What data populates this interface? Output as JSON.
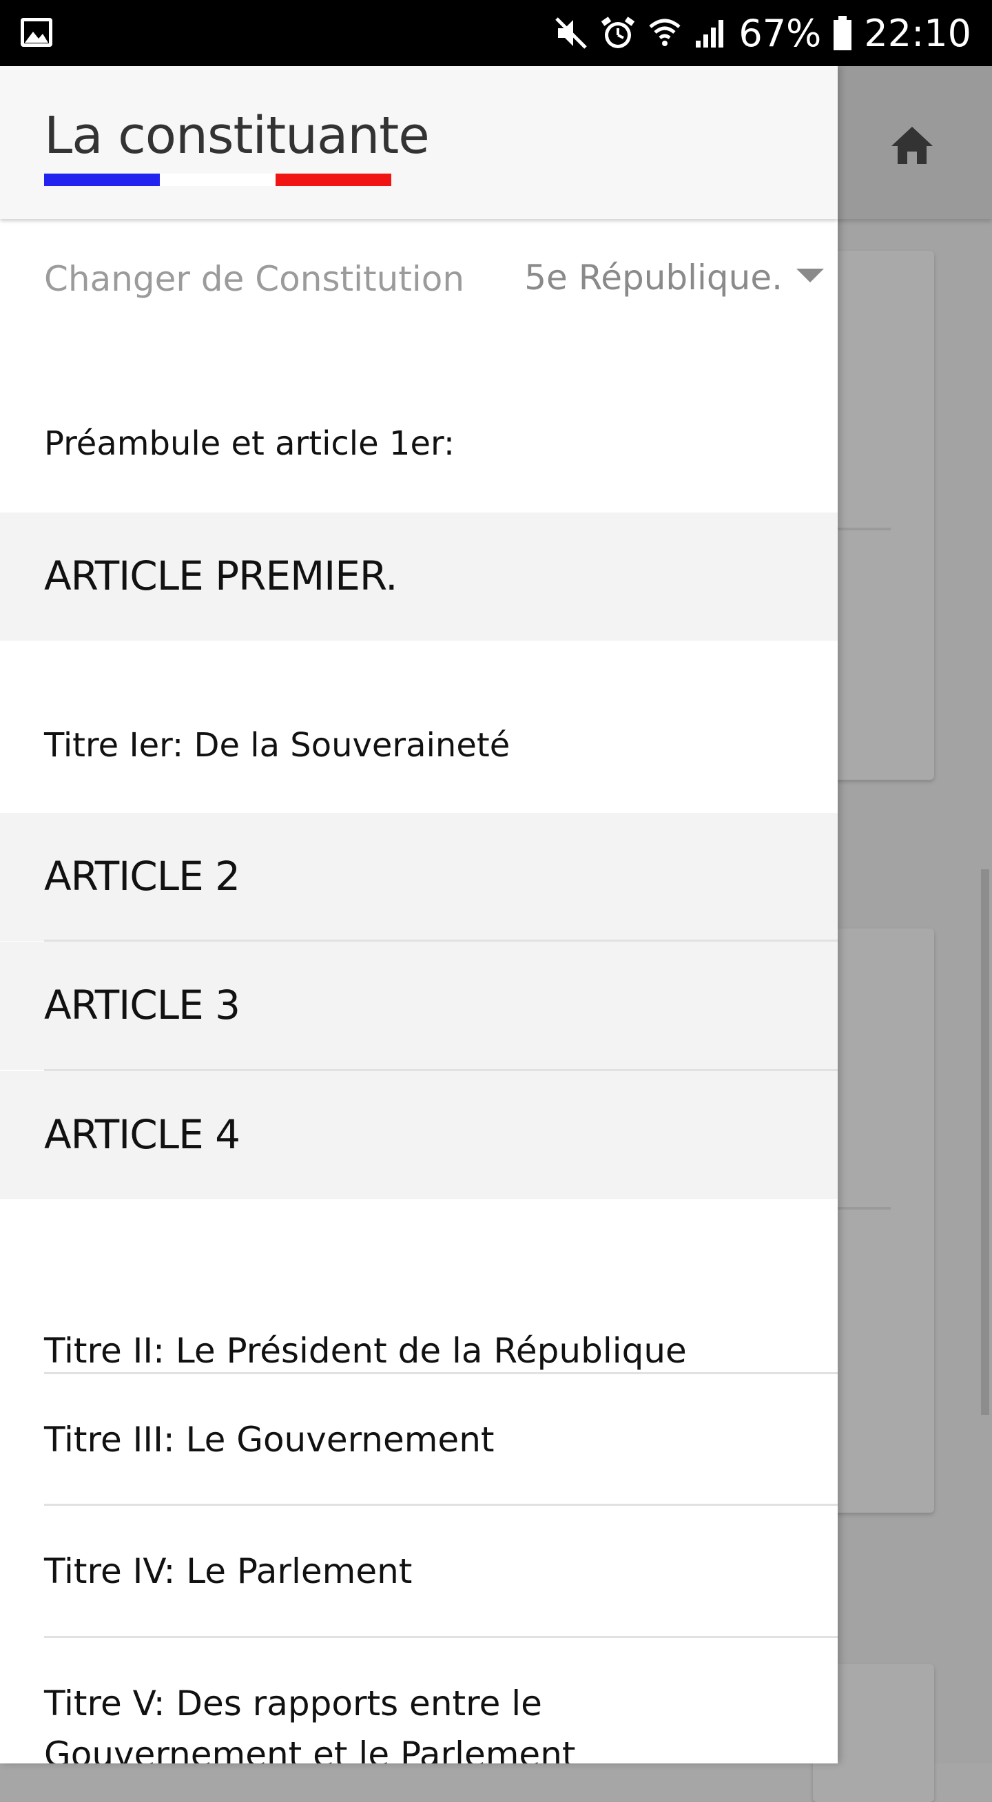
{
  "status_bar": {
    "battery": "67%",
    "time": "22:10",
    "icons": [
      "image-icon",
      "mute-icon",
      "alarm-icon",
      "wifi-icon",
      "signal-icon",
      "battery-icon"
    ]
  },
  "header": {
    "title": "La constituante",
    "flag_colors": [
      "#2323f0",
      "#ffffff",
      "#f01414"
    ],
    "home_icon": "home-icon"
  },
  "constitution": {
    "label": "Changer de Constitution",
    "selected": "5e République."
  },
  "sections": [
    {
      "title": "Préambule et article 1er:",
      "articles": [
        "ARTICLE PREMIER."
      ]
    },
    {
      "title": "Titre Ier: De la Souveraineté",
      "articles": [
        "ARTICLE 2",
        "ARTICLE 3",
        "ARTICLE 4"
      ]
    }
  ],
  "titres": [
    "Titre II: Le Président de la République",
    "Titre III: Le Gouvernement",
    "Titre IV: Le Parlement",
    "Titre V: Des rapports entre le Gouvernement et le Parlement"
  ]
}
